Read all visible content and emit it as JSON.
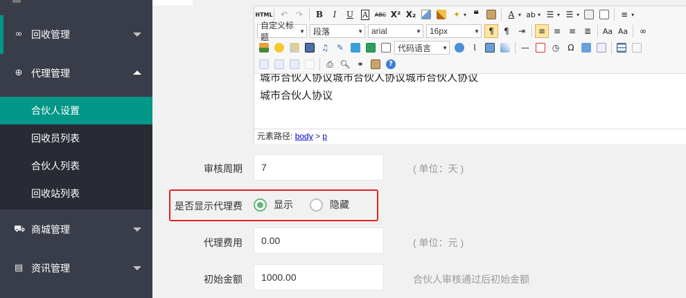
{
  "sidebar": {
    "groups": [
      {
        "icon": "recycle-icon",
        "label": "回收管理"
      },
      {
        "icon": "plus-circle-icon",
        "label": "代理管理"
      },
      {
        "icon": "cart-icon",
        "label": "商城管理"
      },
      {
        "icon": "news-icon",
        "label": "资讯管理"
      }
    ],
    "sub_items": [
      "合伙人设置",
      "回收员列表",
      "合伙人列表",
      "回收站列表"
    ],
    "active_sub": "合伙人设置",
    "accent_color": "#009688"
  },
  "editor": {
    "html_button": "HTML",
    "combos": {
      "custom_title": "自定义标题",
      "paragraph": "段落",
      "font_family": "arial",
      "font_size": "16px",
      "code_language": "代码语言"
    },
    "content_lines": [
      "城市合伙人协议城市合伙人协议城市合伙人协议",
      "城市合伙人协议"
    ],
    "path_label": "元素路径:",
    "path_body": "body",
    "path_sep": ">",
    "path_p": "p"
  },
  "form": {
    "review_period": {
      "label": "审核周期",
      "value": "7",
      "hint": "( 单位：天 )"
    },
    "show_agent_fee": {
      "label": "是否显示代理费",
      "options": [
        {
          "label": "显示",
          "checked": true
        },
        {
          "label": "隐藏",
          "checked": false
        }
      ]
    },
    "agent_fee": {
      "label": "代理费用",
      "value": "0.00",
      "hint": "( 单位：元 )"
    },
    "initial_amount": {
      "label": "初始金额",
      "value": "1000.00",
      "hint": "合伙人审核通过后初始金额"
    }
  },
  "colors": {
    "radio_checked": "#5fb878",
    "highlight_border": "#e02020"
  }
}
